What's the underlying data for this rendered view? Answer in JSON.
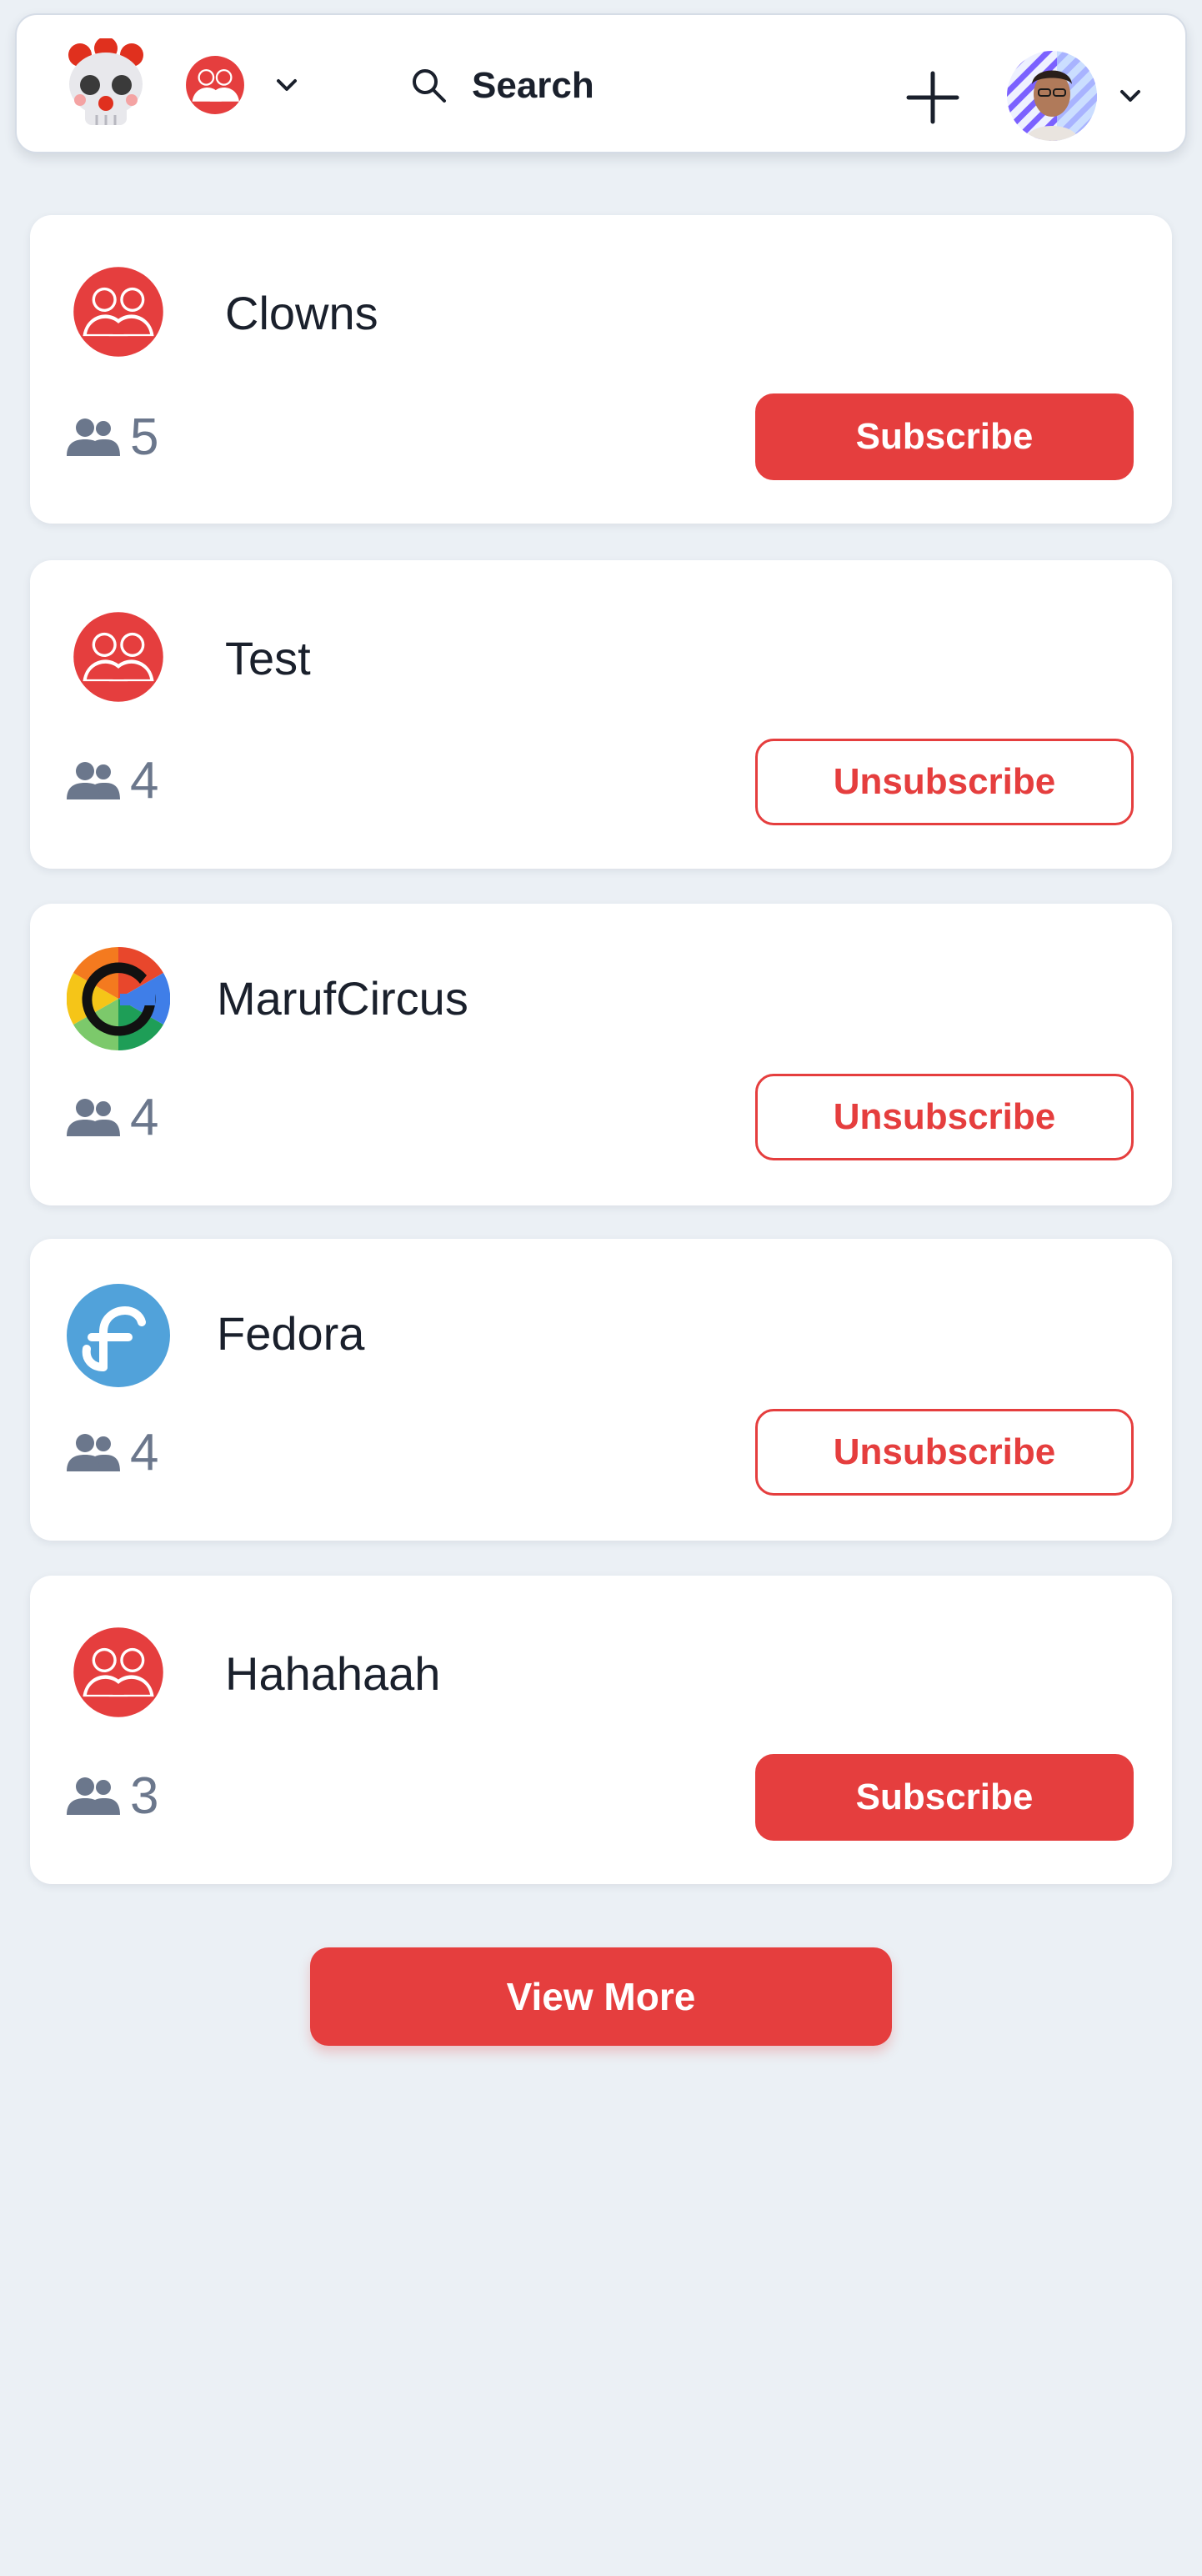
{
  "header": {
    "logo_icon": "skull-clown-icon",
    "community_icon": "community-group-icon",
    "search_label": "Search",
    "create_icon": "plus-icon",
    "profile_icon": "user-avatar"
  },
  "communities": [
    {
      "name": "Clowns",
      "icon": "community-group-icon",
      "members": "5",
      "action": "Subscribe",
      "subscribed": false
    },
    {
      "name": "Test",
      "icon": "community-group-icon",
      "members": "4",
      "action": "Unsubscribe",
      "subscribed": true
    },
    {
      "name": "MarufCircus",
      "icon": "google-g-icon",
      "members": "4",
      "action": "Unsubscribe",
      "subscribed": true
    },
    {
      "name": "Fedora",
      "icon": "fedora-icon",
      "members": "4",
      "action": "Unsubscribe",
      "subscribed": true
    },
    {
      "name": "Hahahaah",
      "icon": "community-group-icon",
      "members": "3",
      "action": "Subscribe",
      "subscribed": false
    }
  ],
  "view_more_label": "View More",
  "colors": {
    "accent": "#e53e3e",
    "background": "#ebf0f5",
    "muted": "#6b778c"
  }
}
